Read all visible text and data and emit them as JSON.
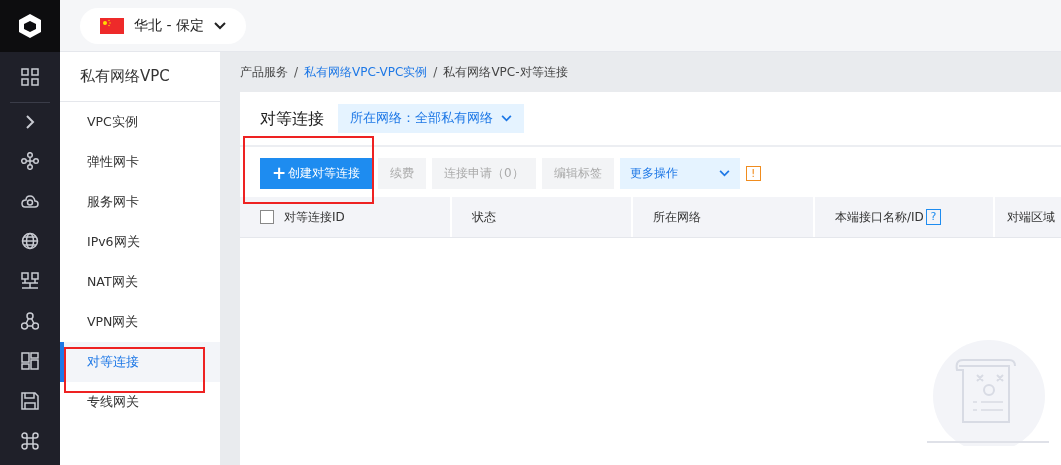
{
  "region": {
    "label": "华北 - 保定"
  },
  "sidebar": {
    "title": "私有网络VPC",
    "items": [
      {
        "label": "VPC实例",
        "selected": false
      },
      {
        "label": "弹性网卡",
        "selected": false
      },
      {
        "label": "服务网卡",
        "selected": false
      },
      {
        "label": "IPv6网关",
        "selected": false
      },
      {
        "label": "NAT网关",
        "selected": false
      },
      {
        "label": "VPN网关",
        "selected": false
      },
      {
        "label": "对等连接",
        "selected": true
      },
      {
        "label": "专线网关",
        "selected": false
      }
    ]
  },
  "breadcrumb_separator": "/",
  "breadcrumb": [
    {
      "label": "产品服务",
      "kind": "plain"
    },
    {
      "label": "私有网络VPC-VPC实例",
      "kind": "link"
    },
    {
      "label": "私有网络VPC-对等连接",
      "kind": "plain"
    }
  ],
  "page_title": "对等连接",
  "network_filter": {
    "label": "所在网络：全部私有网络"
  },
  "toolbar": [
    {
      "label": "创建对等连接",
      "kind": "primary",
      "icon": "+"
    },
    {
      "label": "续费",
      "kind": "disabled"
    },
    {
      "label": "连接申请（0）",
      "kind": "disabled"
    },
    {
      "label": "编辑标签",
      "kind": "disabled"
    },
    {
      "label": "更多操作",
      "kind": "dropdown"
    },
    {
      "label": "!",
      "kind": "warning"
    }
  ],
  "table": {
    "select_all": {
      "checked": false
    },
    "columns": [
      {
        "label": "对等连接ID",
        "kind": "plain"
      },
      {
        "label": "状态",
        "kind": "plain"
      },
      {
        "label": "所在网络",
        "kind": "plain"
      },
      {
        "label": "本端接口名称/ID",
        "kind": "help",
        "help": "?"
      },
      {
        "label": "对端区域",
        "kind": "plain"
      }
    ]
  }
}
